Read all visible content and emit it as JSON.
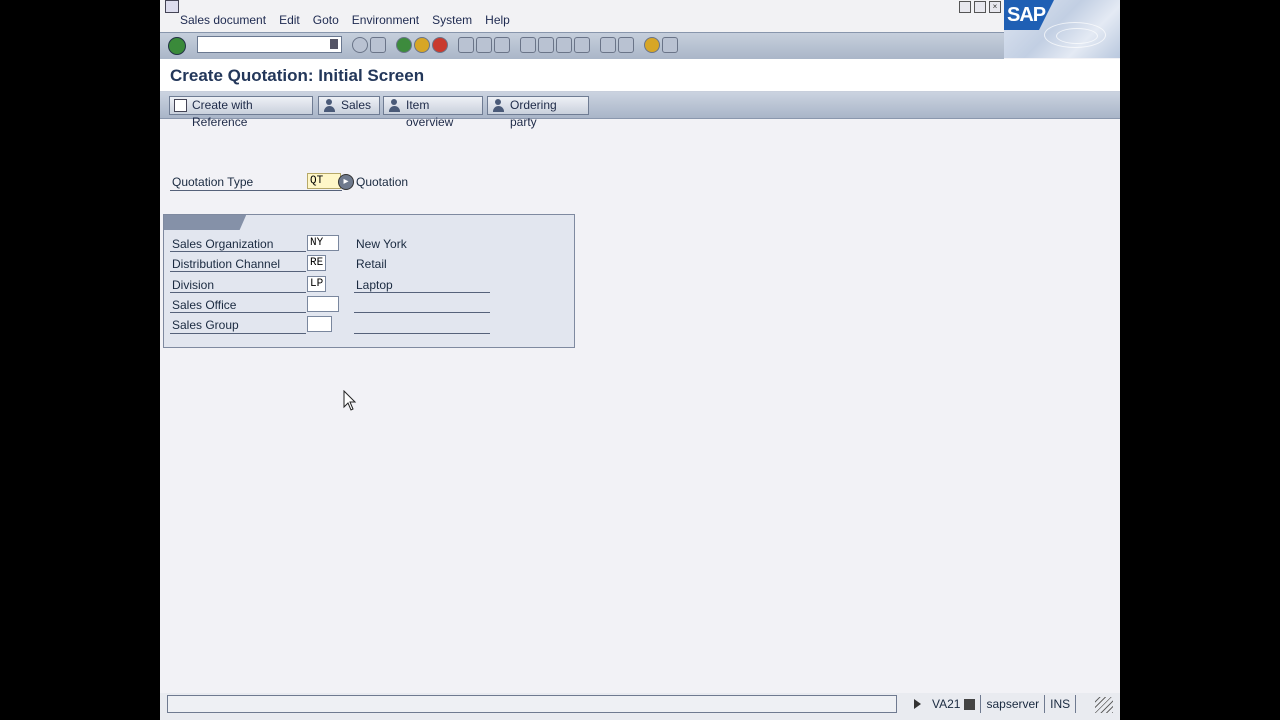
{
  "menu": {
    "items": [
      "Sales document",
      "Edit",
      "Goto",
      "Environment",
      "System",
      "Help"
    ]
  },
  "logo": {
    "text": "SAP"
  },
  "toolbar": {
    "command_value": ""
  },
  "page": {
    "title": "Create Quotation: Initial Screen"
  },
  "app_toolbar": {
    "create_with_reference": "Create with Reference",
    "sales": "Sales",
    "item_overview": "Item overview",
    "ordering_party": "Ordering party"
  },
  "form": {
    "quotation_type": {
      "label": "Quotation Type",
      "value": "QT",
      "description": "Quotation"
    },
    "org_data": {
      "sales_org": {
        "label": "Sales Organization",
        "value": "NY",
        "description": "New York"
      },
      "dist_channel": {
        "label": "Distribution Channel",
        "value": "RE",
        "description": "Retail"
      },
      "division": {
        "label": "Division",
        "value": "LP",
        "description": "Laptop"
      },
      "sales_office": {
        "label": "Sales Office",
        "value": ""
      },
      "sales_group": {
        "label": "Sales Group",
        "value": ""
      }
    }
  },
  "status": {
    "transaction": "VA21",
    "server": "sapserver",
    "mode": "INS"
  },
  "colors": {
    "background": "#f2f2f6",
    "toolbar": "#b6c0d0",
    "required_field": "#fff7c8",
    "title": "#23375a"
  }
}
